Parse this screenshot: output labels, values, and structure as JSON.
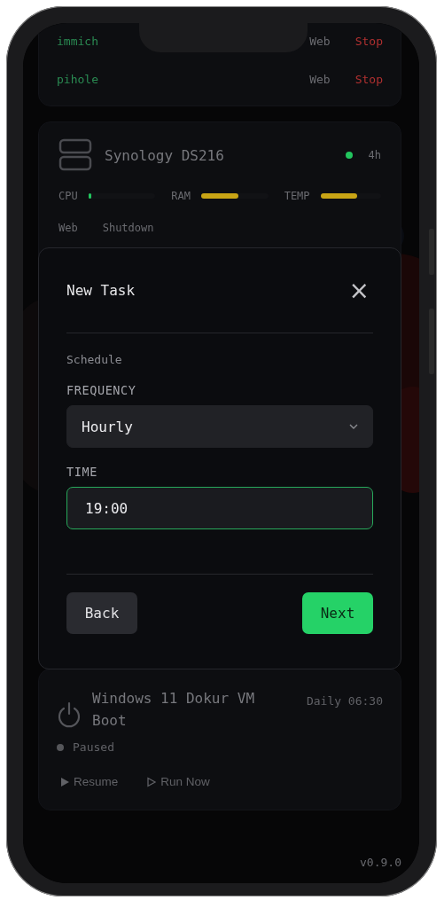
{
  "background": {
    "services": [
      {
        "name": "immich",
        "actions": [
          {
            "label": "Web",
            "kind": "link"
          },
          {
            "label": "Stop",
            "kind": "danger"
          }
        ]
      },
      {
        "name": "pihole",
        "actions": [
          {
            "label": "Web",
            "kind": "link"
          },
          {
            "label": "Stop",
            "kind": "danger"
          }
        ]
      }
    ],
    "device": {
      "name": "Synology DS216",
      "online": true,
      "uptime": "4h",
      "metrics": [
        {
          "label": "CPU",
          "level": 0.05,
          "color": "#22c55e"
        },
        {
          "label": "RAM",
          "level": 0.55,
          "color": "#c8a415"
        },
        {
          "label": "TEMP",
          "level": 0.6,
          "color": "#c8a415"
        }
      ],
      "actions": [
        "Web",
        "Shutdown"
      ]
    },
    "task": {
      "title": "Windows 11 Dokur VM Boot",
      "schedule": "Daily 06:30",
      "status": "Paused",
      "active": false,
      "actions": [
        {
          "label": "Resume",
          "kind": "play"
        },
        {
          "label": "Run Now",
          "kind": "play-outline"
        }
      ]
    },
    "version": "v0.9.0"
  },
  "modal": {
    "title": "New Task",
    "close": "×",
    "section": "Schedule",
    "fields": [
      {
        "label": "FREQUENCY",
        "kind": "select",
        "value": "Hourly",
        "focused": false
      },
      {
        "label": "TIME",
        "kind": "input",
        "value": "19:00",
        "focused": true
      }
    ],
    "buttons": [
      {
        "label": "Back",
        "kind": "secondary"
      },
      {
        "label": "Next",
        "kind": "primary"
      }
    ]
  }
}
